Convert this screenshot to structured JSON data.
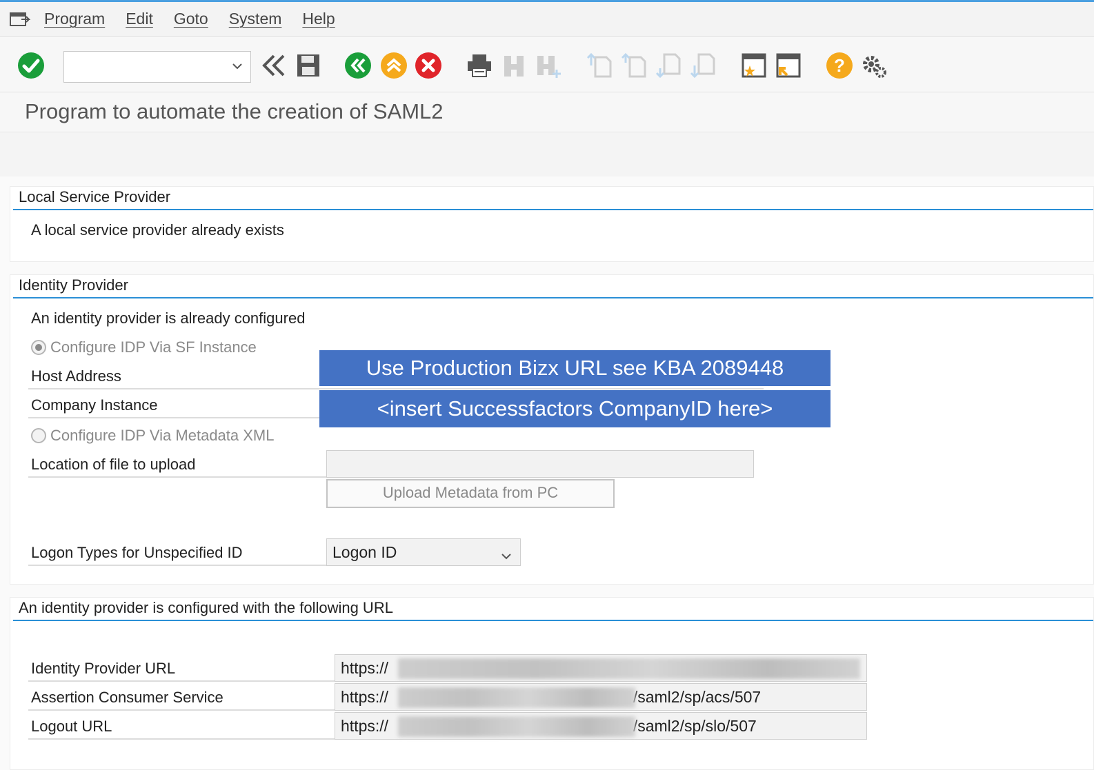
{
  "menu": {
    "items": [
      "Program",
      "Edit",
      "Goto",
      "System",
      "Help"
    ]
  },
  "toolbar": {
    "command_value": "",
    "icons": [
      "enter-check-icon",
      "back-double-arrow-icon",
      "save-icon",
      "back-icon",
      "exit-icon",
      "cancel-icon",
      "print-icon",
      "find-icon",
      "find-next-icon",
      "first-page-icon",
      "previous-page-icon",
      "next-page-icon",
      "last-page-icon",
      "create-session-icon",
      "shortcut-icon",
      "help-icon",
      "settings-gear-icon"
    ]
  },
  "title": "Program to automate the creation of SAML2",
  "local_sp": {
    "title": "Local Service Provider",
    "message": "A local service provider already exists"
  },
  "idp": {
    "title": "Identity Provider",
    "message": "An identity provider is already configured",
    "radio_sf": "Configure IDP Via SF Instance",
    "host_address_label": "Host Address",
    "company_instance_label": "Company Instance",
    "radio_metadata": "Configure IDP Via Metadata XML",
    "location_label": "Location of file to upload",
    "location_value": "",
    "upload_button": "Upload Metadata from PC",
    "logon_types_label": "Logon Types for Unspecified ID",
    "logon_types_value": "Logon ID"
  },
  "annotations": {
    "host_address": "Use Production Bizx URL see KBA 2089448",
    "company_instance": "<insert Successfactors CompanyID here>"
  },
  "urls": {
    "title": "An identity provider is configured with the following URL",
    "idp_url_label": "Identity Provider URL",
    "idp_url_prefix": "https://",
    "acs_label": "Assertion Consumer Service",
    "acs_prefix": "https://",
    "acs_suffix": "/saml2/sp/acs/507",
    "logout_label": "Logout URL",
    "logout_prefix": "https://",
    "logout_suffix": "/saml2/sp/slo/507"
  },
  "colors": {
    "accent": "#2a8fd6",
    "banner": "#4472c4",
    "ok_green": "#1a9e3a",
    "exit_yellow": "#f5a91c",
    "cancel_red": "#e0242a"
  }
}
